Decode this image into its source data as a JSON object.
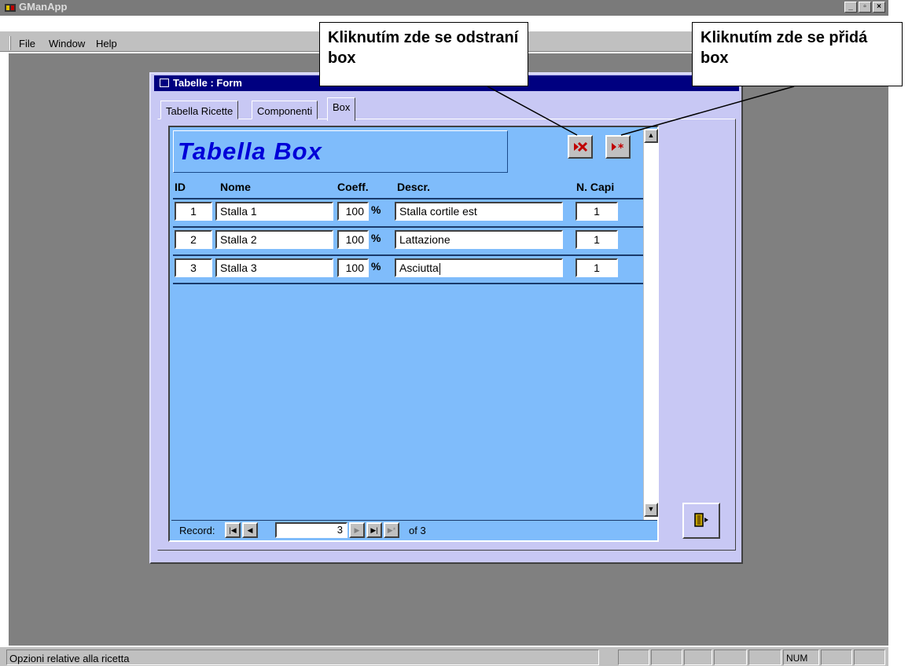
{
  "app": {
    "title": "GManApp"
  },
  "menu": {
    "file": "File",
    "window": "Window",
    "help": "Help"
  },
  "form": {
    "title": "Tabelle : Form",
    "tabs": [
      "Tabella Ricette",
      "Componenti",
      "Box"
    ],
    "active_tab": "Box"
  },
  "subform": {
    "title": "Tabella Box",
    "headers": {
      "id": "ID",
      "nome": "Nome",
      "coeff": "Coeff.",
      "descr": "Descr.",
      "capi": "N. Capi"
    },
    "percent_symbol": "%",
    "rows": [
      {
        "id": "1",
        "nome": "Stalla 1",
        "coeff": "100",
        "descr": "Stalla cortile est",
        "capi": "1"
      },
      {
        "id": "2",
        "nome": "Stalla 2",
        "coeff": "100",
        "descr": "Lattazione",
        "capi": "1"
      },
      {
        "id": "3",
        "nome": "Stalla 3",
        "coeff": "100",
        "descr": "Asciutta",
        "capi": "1"
      }
    ]
  },
  "navigation": {
    "label": "Record:",
    "current": "3",
    "of_text": "of 3"
  },
  "callouts": {
    "delete": "Kliknutím zde se odstraní box",
    "add": "Kliknutím zde se přidá box"
  },
  "status": {
    "text": "Opzioni relative alla ricetta",
    "num": "NUM"
  }
}
